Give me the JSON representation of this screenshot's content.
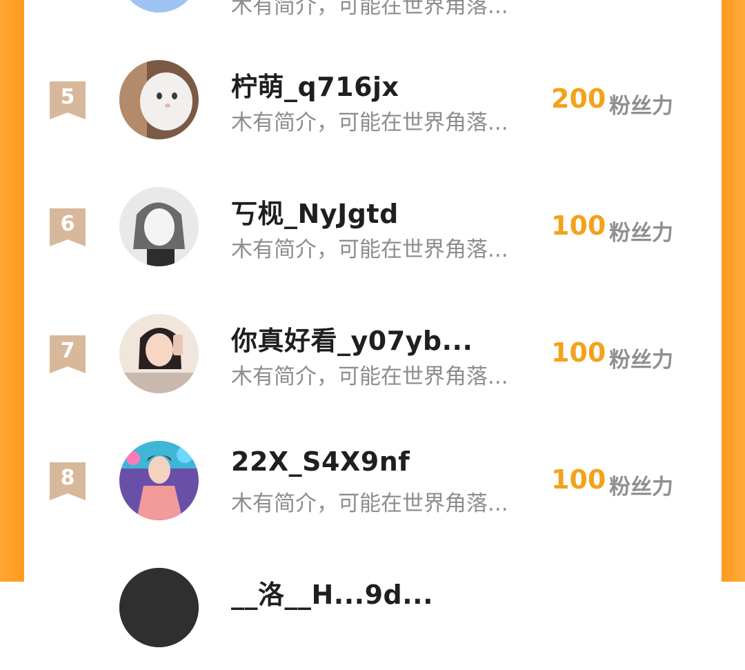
{
  "rows": [
    {
      "rank": "",
      "name": "",
      "bio": "木有简介，可能在世界角落...",
      "score": "",
      "unit": ""
    },
    {
      "rank": "5",
      "name": "柠萌_q716jx",
      "bio": "木有简介，可能在世界角落...",
      "score": "200",
      "unit": "粉丝力"
    },
    {
      "rank": "6",
      "name": "丂枧_NyJgtd",
      "bio": "木有简介，可能在世界角落...",
      "score": "100",
      "unit": "粉丝力"
    },
    {
      "rank": "7",
      "name": "你真好看_y07yb...",
      "bio": "木有简介，可能在世界角落...",
      "score": "100",
      "unit": "粉丝力"
    },
    {
      "rank": "8",
      "name": "22X_S4X9nf",
      "bio": "木有简介，可能在世界角落...",
      "score": "100",
      "unit": "粉丝力"
    },
    {
      "rank": "",
      "name": "__洛__H...9d...",
      "bio": "",
      "score": "",
      "unit": ""
    }
  ],
  "colors": {
    "frame": "#ff9a1f",
    "score": "#f3a21b",
    "rank_badge": "#d8b89a",
    "name": "#1f1f1f",
    "bio": "#8d8d8d"
  }
}
